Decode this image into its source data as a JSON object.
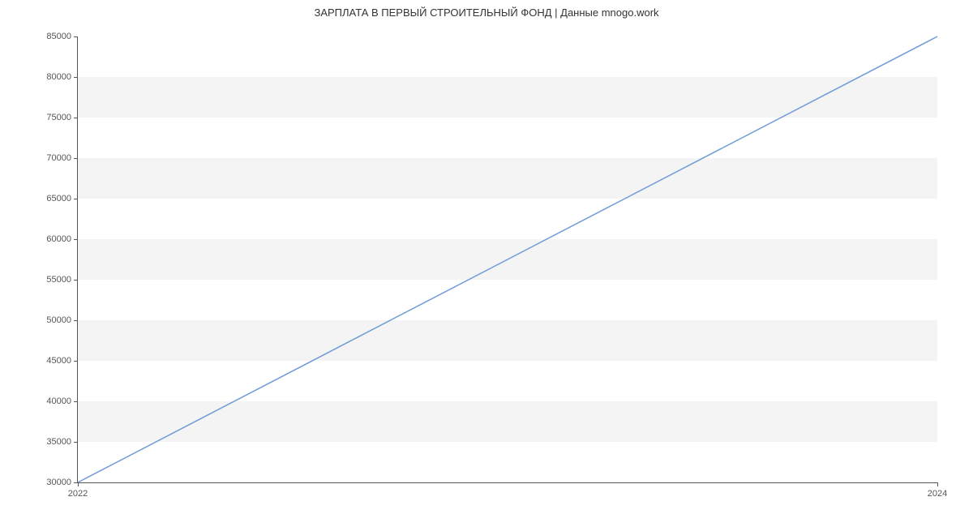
{
  "chart_data": {
    "type": "line",
    "title": "ЗАРПЛАТА В  ПЕРВЫЙ СТРОИТЕЛЬНЫЙ ФОНД | Данные mnogo.work",
    "xlabel": "",
    "ylabel": "",
    "x": [
      2022,
      2024
    ],
    "values": [
      30000,
      85000
    ],
    "x_ticks": [
      2022,
      2024
    ],
    "y_ticks": [
      30000,
      35000,
      40000,
      45000,
      50000,
      55000,
      60000,
      65000,
      70000,
      75000,
      80000,
      85000
    ],
    "ylim": [
      30000,
      85000
    ],
    "xlim": [
      2022,
      2024
    ],
    "line_color": "#6f9bd8"
  }
}
